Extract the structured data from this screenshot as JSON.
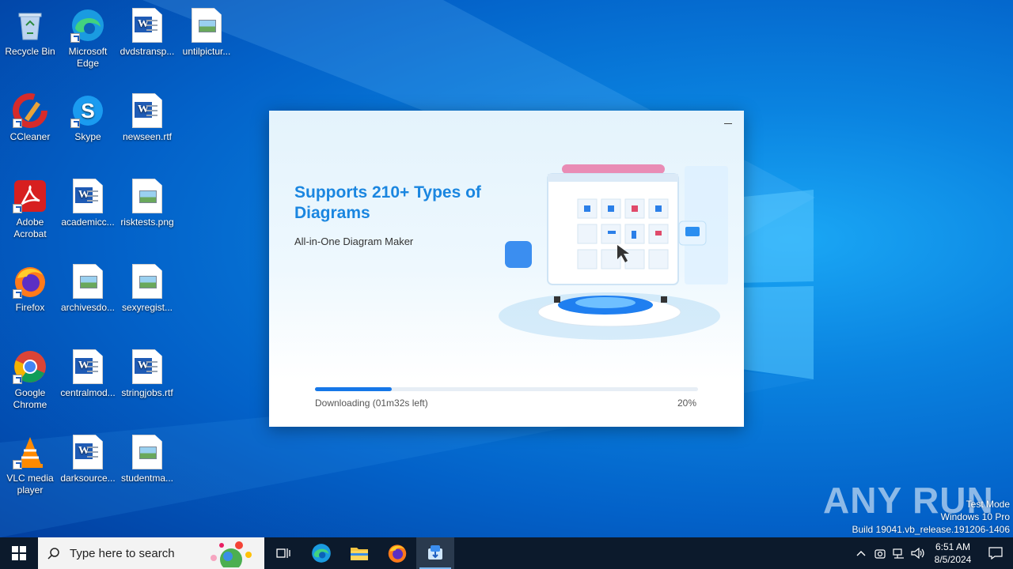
{
  "desktop": {
    "icons": [
      {
        "label": "Recycle Bin"
      },
      {
        "label": "Microsoft Edge"
      },
      {
        "label": "dvdstransp..."
      },
      {
        "label": "untilpictur..."
      },
      {
        "label": "CCleaner"
      },
      {
        "label": "Skype"
      },
      {
        "label": "newseen.rtf"
      },
      {
        "label": "Adobe Acrobat"
      },
      {
        "label": "academicc..."
      },
      {
        "label": "risktests.png"
      },
      {
        "label": "Firefox"
      },
      {
        "label": "archivesdo..."
      },
      {
        "label": "sexyregist..."
      },
      {
        "label": "Google Chrome"
      },
      {
        "label": "centralmod..."
      },
      {
        "label": "stringjobs.rtf"
      },
      {
        "label": "VLC media player"
      },
      {
        "label": "darksource..."
      },
      {
        "label": "studentma..."
      }
    ]
  },
  "installer": {
    "headline": "Supports 210+ Types of Diagrams",
    "subline": "All-in-One Diagram Maker",
    "status": "Downloading (01m32s left)",
    "percent_label": "20%",
    "progress": 0.2,
    "accent": "#1677e8"
  },
  "watermark": {
    "brand": "ANY RUN",
    "mode": "Test Mode",
    "os": "Windows 10 Pro",
    "build": "Build 19041.vb_release.191206-1406"
  },
  "taskbar": {
    "search_placeholder": "Type here to search",
    "time": "6:51 AM",
    "date": "8/5/2024"
  }
}
